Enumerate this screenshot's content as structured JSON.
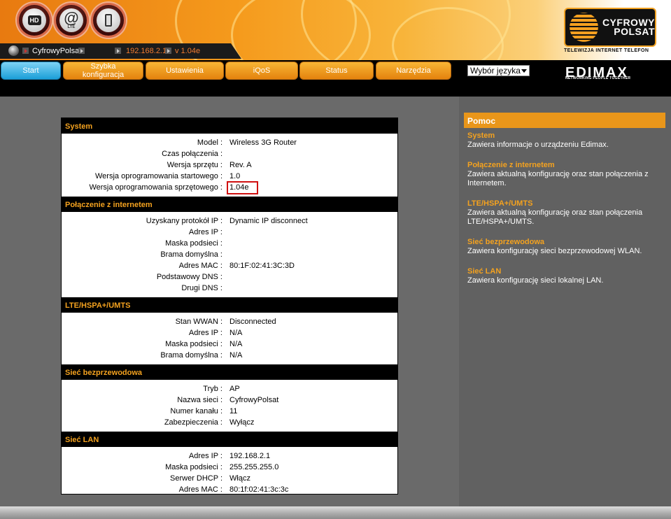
{
  "header": {
    "info_name": "CyfrowyPolsat",
    "info_ip": "192.168.2.1",
    "info_version": "v 1.04e",
    "brand_line1": "CYFROWY",
    "brand_line2": "POLSAT",
    "brand_sub": "TELEWIZJA  INTERNET  TELEFON",
    "icons": [
      "hd-icon",
      "lte-icon",
      "phone-icon"
    ],
    "hd_label": "HD",
    "lte_label": "LTE"
  },
  "nav": {
    "tabs": [
      {
        "label": "Start",
        "active": true
      },
      {
        "label": "Szybka konfiguracja",
        "active": false
      },
      {
        "label": "Ustawienia",
        "active": false
      },
      {
        "label": "iQoS",
        "active": false
      },
      {
        "label": "Status",
        "active": false
      },
      {
        "label": "Narzędzia",
        "active": false
      }
    ],
    "language_select": "Wybór języka",
    "logo": "EDIMAX",
    "logo_sub": "NETWORKING PEOPLE TOGETHER"
  },
  "sections": [
    {
      "title": "System",
      "rows": [
        {
          "label": "Model :",
          "value": "Wireless 3G Router"
        },
        {
          "label": "Czas połączenia :",
          "value": ""
        },
        {
          "label": "Wersja sprzętu :",
          "value": "Rev. A"
        },
        {
          "label": "Wersja oprogramowania startowego :",
          "value": "1.0"
        },
        {
          "label": "Wersja oprogramowania sprzętowego :",
          "value": "1.04e"
        }
      ]
    },
    {
      "title": "Połączenie z internetem",
      "rows": [
        {
          "label": "Uzyskany protokół IP :",
          "value": "Dynamic IP disconnect"
        },
        {
          "label": "Adres IP :",
          "value": ""
        },
        {
          "label": "Maska podsieci :",
          "value": ""
        },
        {
          "label": "Brama domyślna :",
          "value": ""
        },
        {
          "label": "Adres MAC :",
          "value": "80:1F:02:41:3C:3D"
        },
        {
          "label": "Podstawowy DNS :",
          "value": ""
        },
        {
          "label": "Drugi DNS :",
          "value": ""
        }
      ]
    },
    {
      "title": "LTE/HSPA+/UMTS",
      "rows": [
        {
          "label": "Stan WWAN :",
          "value": "Disconnected"
        },
        {
          "label": "Adres IP :",
          "value": "N/A"
        },
        {
          "label": "Maska podsieci :",
          "value": "N/A"
        },
        {
          "label": "Brama domyślna :",
          "value": "N/A"
        }
      ]
    },
    {
      "title": "Sieć bezprzewodowa",
      "rows": [
        {
          "label": "Tryb :",
          "value": "AP"
        },
        {
          "label": "Nazwa sieci :",
          "value": "CyfrowyPolsat"
        },
        {
          "label": "Numer kanału :",
          "value": "11"
        },
        {
          "label": "Zabezpieczenia :",
          "value": "Wyłącz"
        }
      ]
    },
    {
      "title": "Sieć LAN",
      "rows": [
        {
          "label": "Adres IP :",
          "value": "192.168.2.1"
        },
        {
          "label": "Maska podsieci :",
          "value": "255.255.255.0"
        },
        {
          "label": "Serwer DHCP :",
          "value": "Włącz"
        },
        {
          "label": "Adres MAC :",
          "value": "80:1f:02:41:3c:3c"
        }
      ]
    }
  ],
  "help": {
    "title": "Pomoc",
    "items": [
      {
        "title": "System",
        "text": "Zawiera informacje o urządzeniu Edimax."
      },
      {
        "title": "Połączenie z internetem",
        "text": "Zawiera aktualną konfigurację oraz stan połączenia z Internetem."
      },
      {
        "title": "LTE/HSPA+/UMTS",
        "text": "Zawiera aktualną konfigurację oraz stan połączenia LTE/HSPA+/UMTS."
      },
      {
        "title": "Sieć bezprzewodowa",
        "text": "Zawiera konfigurację sieci bezprzewodowej WLAN."
      },
      {
        "title": "Sieć LAN",
        "text": "Zawiera konfigurację sieci lokalnej LAN."
      }
    ]
  },
  "colors": {
    "accent_orange": "#f4a21f",
    "active_tab_blue": "#1b9fd8",
    "highlight_red": "#d01010"
  }
}
